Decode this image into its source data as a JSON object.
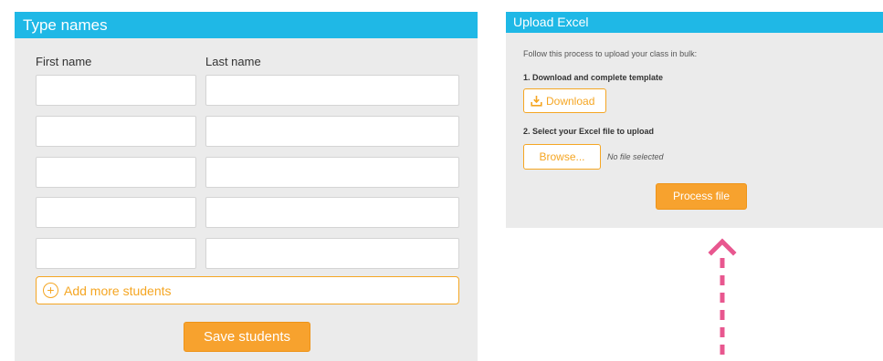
{
  "type_names": {
    "title": "Type names",
    "first_name_label": "First name",
    "last_name_label": "Last name",
    "rows": [
      {
        "first": "",
        "last": ""
      },
      {
        "first": "",
        "last": ""
      },
      {
        "first": "",
        "last": ""
      },
      {
        "first": "",
        "last": ""
      },
      {
        "first": "",
        "last": ""
      }
    ],
    "add_more_label": "Add more students",
    "save_label": "Save students"
  },
  "upload_excel": {
    "title": "Upload Excel",
    "instructions": "Follow this process to upload your class in bulk:",
    "step1": "1. Download and complete template",
    "download_label": "Download",
    "step2": "2. Select your Excel file to upload",
    "browse_label": "Browse...",
    "no_file_text": "No file selected",
    "process_label": "Process file"
  },
  "colors": {
    "header_blue": "#1fb8e6",
    "accent_orange": "#f5a623",
    "panel_grey": "#ebebeb",
    "arrow_pink": "#e8578f"
  },
  "icons": {
    "add_more": "plus-circle-icon",
    "download": "download-tray-icon",
    "arrow": "arrow-up-icon"
  }
}
